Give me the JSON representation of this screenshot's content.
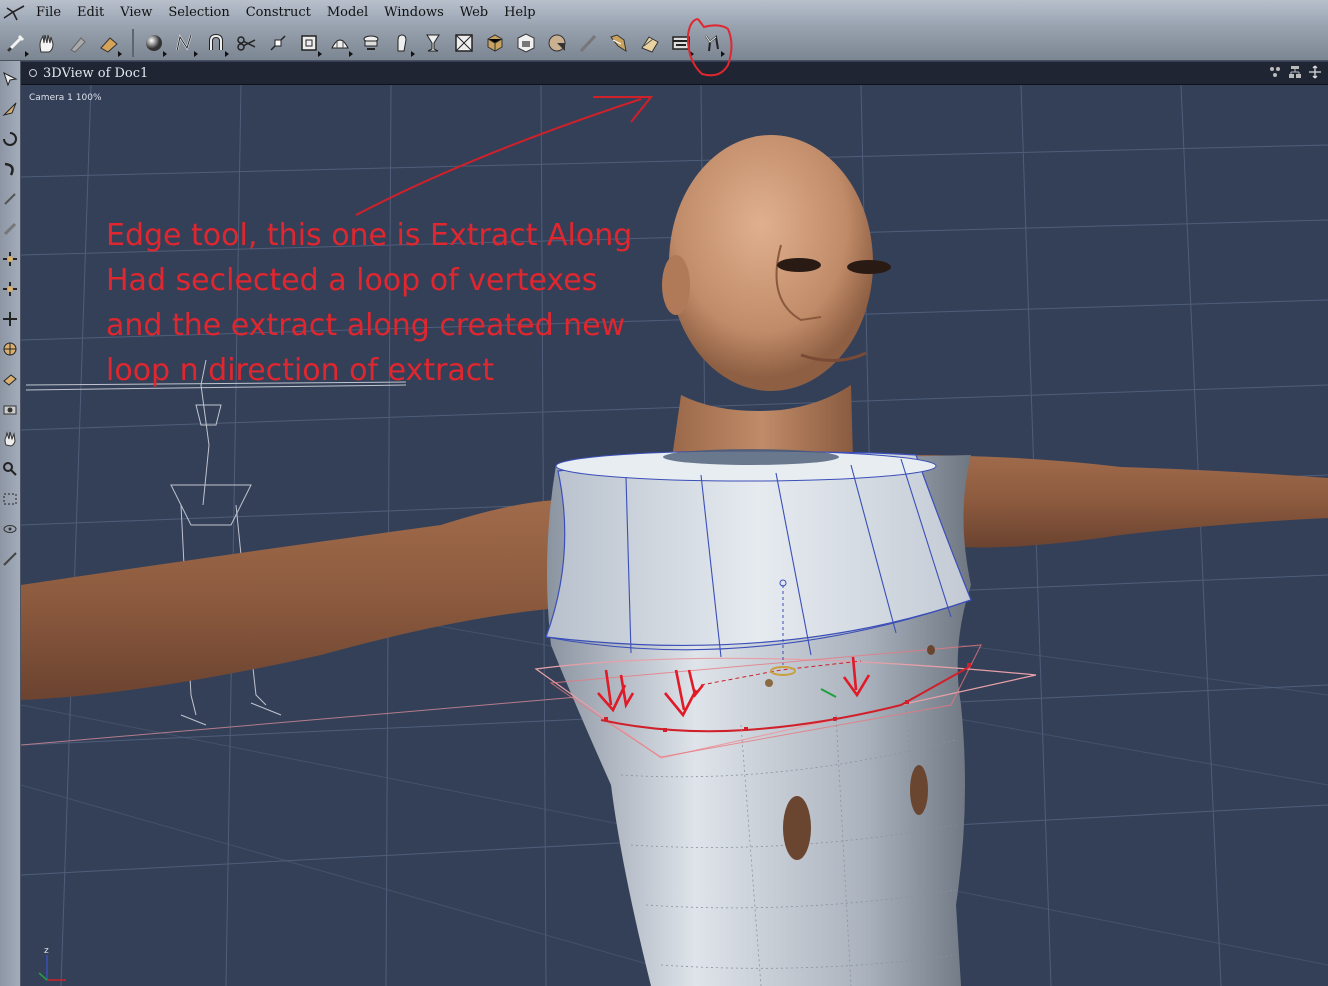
{
  "menubar": {
    "items": [
      "File",
      "Edit",
      "View",
      "Selection",
      "Construct",
      "Model",
      "Windows",
      "Web",
      "Help"
    ]
  },
  "toolbar": {
    "tools": [
      "brush-icon",
      "hand-icon",
      "paint-icon",
      "eraser-icon",
      "sphere-icon",
      "pen-icon",
      "magnet-icon",
      "scissors-icon",
      "vertex-icon",
      "bevel-icon",
      "dome-icon",
      "extrude-icon",
      "shape-icon",
      "lathe-icon",
      "box-select-icon",
      "cube-icon",
      "texture-icon",
      "material-ball-icon",
      "wand-icon",
      "figure-icon",
      "bend-icon",
      "extract-along-icon",
      "morph-icon"
    ],
    "highlighted": "extract-along-icon"
  },
  "view": {
    "title": "3DView of Doc1",
    "camera_label": "Camera 1 100%"
  },
  "annotation": {
    "lines": [
      "Edge tool, this one is Extract Along",
      "Had seclected a loop of vertexes",
      "and the extract along created new",
      "loop n direction of extract"
    ],
    "color": "#e0262e"
  },
  "colors": {
    "grid": "#5a6884",
    "viewport": "#344058",
    "skin": "#b98462",
    "mesh": "#c9d0da"
  }
}
